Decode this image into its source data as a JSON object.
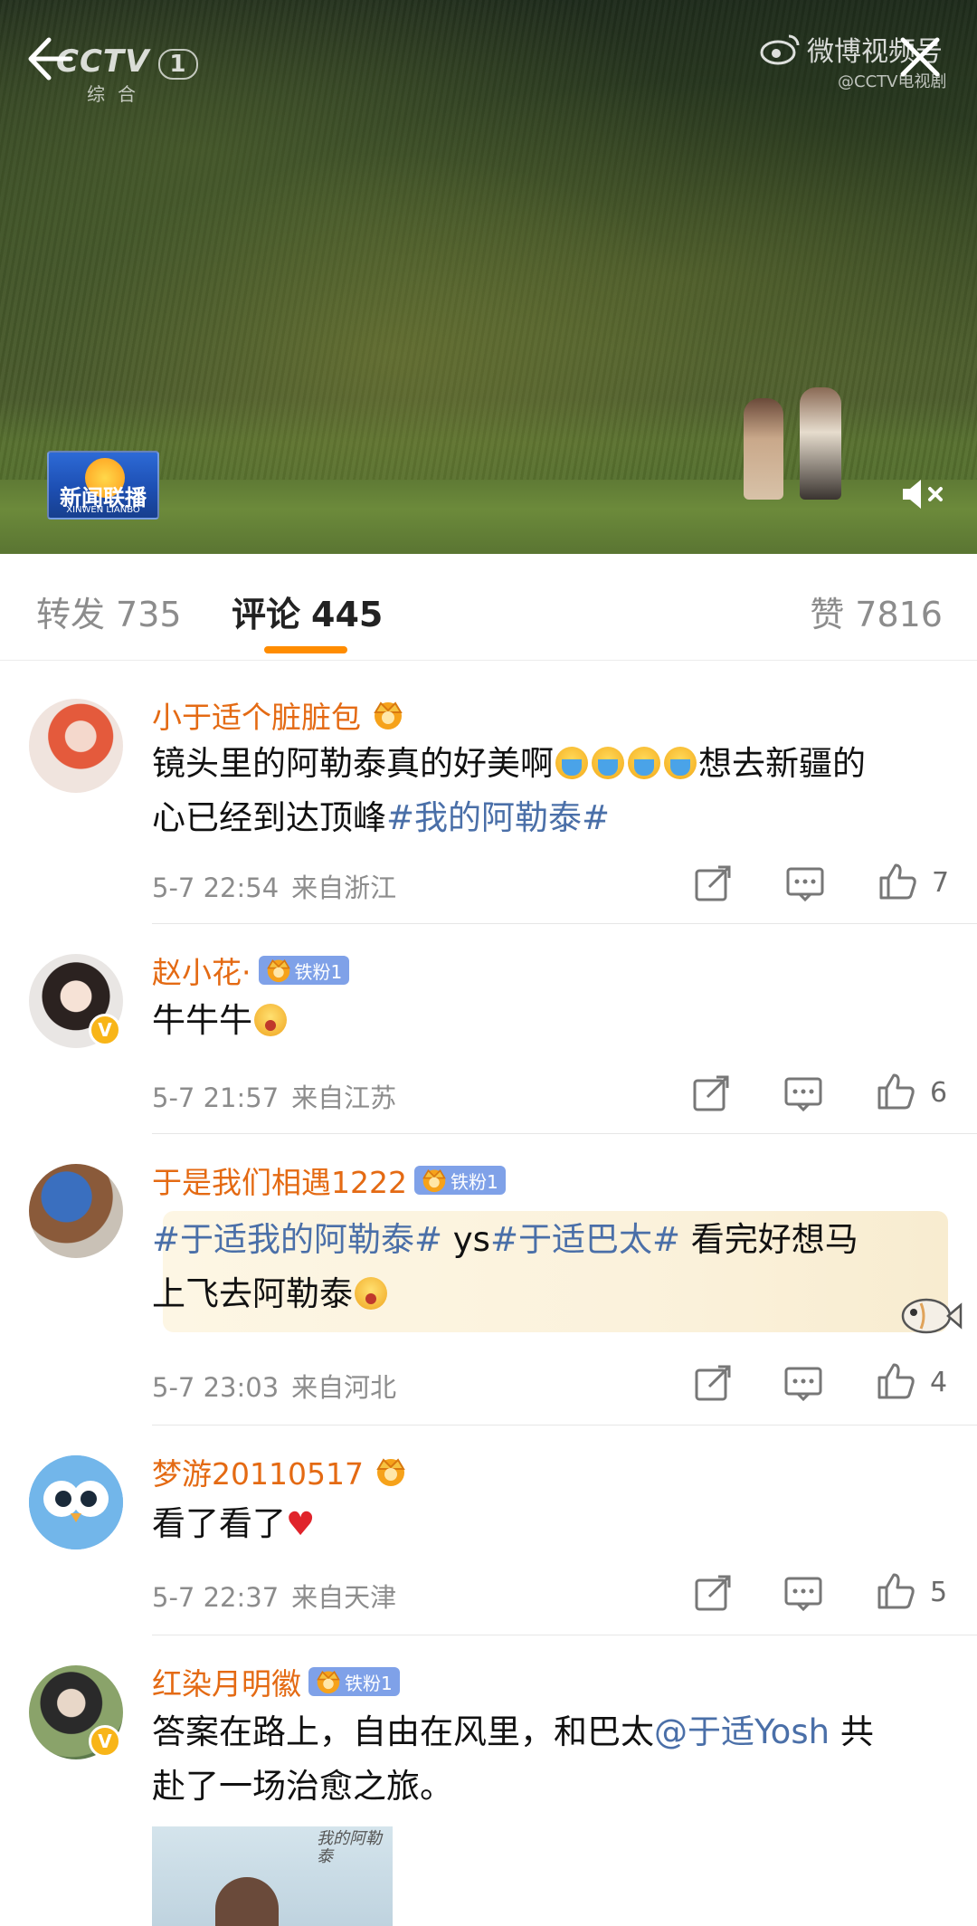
{
  "video": {
    "channel_logo": "CCTV",
    "channel_number": "1",
    "channel_sub": "综合",
    "weibo_mark": "微博视频号",
    "weibo_source": "@CCTV电视剧",
    "program_logo": "新闻联播",
    "program_logo_pinyin": "XINWEN LIANBO"
  },
  "tabs": {
    "repost_label": "转发",
    "repost_count": "735",
    "comments_label": "评论",
    "comments_count": "445",
    "likes_label": "赞",
    "likes_count": "7816",
    "active": "comments",
    "accent_color": "#ff8c00"
  },
  "comments": [
    {
      "username": "小于适个脏脏包",
      "fan_badge": "",
      "text_a": "镜头里的阿勒泰真的好美啊",
      "text_b": "想去新疆的",
      "text_c": "心已经到达顶峰",
      "hashtag": "#我的阿勒泰#",
      "time": "5-7 22:54",
      "location": "来自浙江",
      "likes": "7"
    },
    {
      "username": "赵小花·",
      "fan_badge": "铁粉1",
      "text": "牛牛牛",
      "time": "5-7 21:57",
      "location": "来自江苏",
      "likes": "6"
    },
    {
      "username": "于是我们相遇1222",
      "fan_badge": "铁粉1",
      "hashtag1": "#于适我的阿勒泰#",
      "text_mid": " ys",
      "hashtag2": "#于适巴太#",
      "text_end": " 看完好想马",
      "text_line2": "上飞去阿勒泰",
      "time": "5-7 23:03",
      "location": "来自河北",
      "likes": "4"
    },
    {
      "username": "梦游20110517",
      "fan_badge": "",
      "text": "看了看了",
      "time": "5-7 22:37",
      "location": "来自天津",
      "likes": "5"
    },
    {
      "username": "红染月明徽",
      "fan_badge": "铁粉1",
      "text_a": "答案在路上，自由在风里，和巴太",
      "mention": "@于适Yosh",
      "text_b": " 共",
      "text_line2": "赴了一场治愈之旅。",
      "photo_caption": "我的阿勒泰"
    }
  ],
  "icons": {
    "share": "share-icon",
    "comment": "comment-icon",
    "like": "thumb-up-icon",
    "crown": "crown-icon",
    "mute": "mute-icon",
    "back": "back-arrow-icon",
    "close": "close-icon"
  }
}
